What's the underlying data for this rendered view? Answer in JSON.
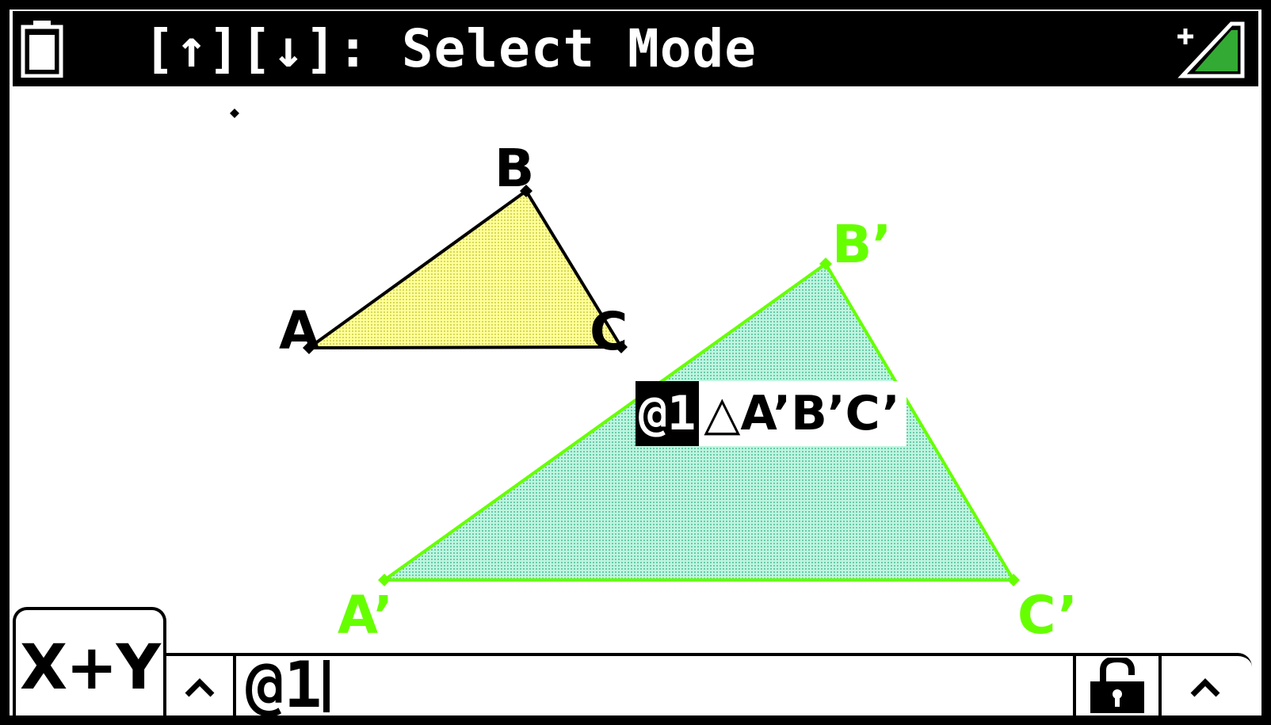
{
  "header": {
    "title": "[↑][↓]: Select Mode",
    "icons": [
      "battery-icon",
      "charging-icon"
    ]
  },
  "construction": {
    "triangle_original": {
      "vertex_labels": [
        "A",
        "B",
        "C"
      ],
      "fill": "#ffff66",
      "stroke": "#000000"
    },
    "triangle_image": {
      "vertex_labels": [
        "A’",
        "B’",
        "C’"
      ],
      "fill": "#99ffcc",
      "stroke": "#66ff00"
    }
  },
  "tooltip": {
    "id": "@1",
    "label": "△A’B’C’"
  },
  "input_bar": {
    "tab_label": "X+Y",
    "entry_value": "@1",
    "icons": [
      "chevron-up-icon",
      "unlock-icon",
      "chevron-up-icon"
    ]
  }
}
